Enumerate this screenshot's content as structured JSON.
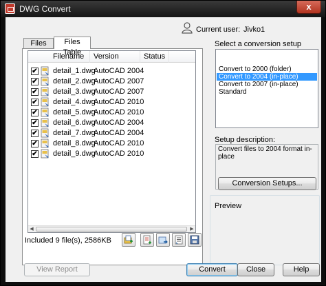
{
  "window": {
    "title": "DWG Convert",
    "close_glyph": "x"
  },
  "user": {
    "label": "Current user:",
    "name": "Jivko1",
    "icon": "user-icon"
  },
  "tabs": [
    {
      "label": "Files Tree",
      "active": false
    },
    {
      "label": "Files Table",
      "active": true
    }
  ],
  "file_table": {
    "columns": [
      "Filename",
      "Version",
      "Status"
    ],
    "rows": [
      {
        "checked": true,
        "filename": "detail_1.dwg",
        "version": "AutoCAD 2004",
        "status": ""
      },
      {
        "checked": true,
        "filename": "detail_2.dwg",
        "version": "AutoCAD 2007",
        "status": ""
      },
      {
        "checked": true,
        "filename": "detail_3.dwg",
        "version": "AutoCAD 2007",
        "status": ""
      },
      {
        "checked": true,
        "filename": "detail_4.dwg",
        "version": "AutoCAD 2010",
        "status": ""
      },
      {
        "checked": true,
        "filename": "detail_5.dwg",
        "version": "AutoCAD 2010",
        "status": ""
      },
      {
        "checked": true,
        "filename": "detail_6.dwg",
        "version": "AutoCAD 2004",
        "status": ""
      },
      {
        "checked": true,
        "filename": "detail_7.dwg",
        "version": "AutoCAD 2004",
        "status": ""
      },
      {
        "checked": true,
        "filename": "detail_8.dwg",
        "version": "AutoCAD 2010",
        "status": ""
      },
      {
        "checked": true,
        "filename": "detail_9.dwg",
        "version": "AutoCAD 2010",
        "status": ""
      }
    ],
    "check_glyph": "✔"
  },
  "summary": "Included 9 file(s), 2586KB",
  "toolbar_icons": [
    "add-files-icon",
    "add-folder-icon",
    "remove-files-icon",
    "file-list-icon",
    "save-list-icon"
  ],
  "setup": {
    "label": "Select a conversion setup",
    "options": [
      "Convert to 2000 (folder)",
      "Convert to 2004 (in-place)",
      "Convert to 2007 (in-place)",
      "Standard"
    ],
    "selected_index": 1,
    "description_label": "Setup description:",
    "description": "Convert files to 2004 format in-place",
    "setups_button": "Conversion Setups..."
  },
  "preview": {
    "label": "Preview"
  },
  "buttons": {
    "view_report": "View Report",
    "convert": "Convert",
    "close": "Close",
    "help": "Help"
  },
  "colors": {
    "selection": "#3399ff",
    "titlebar": "#151515"
  }
}
